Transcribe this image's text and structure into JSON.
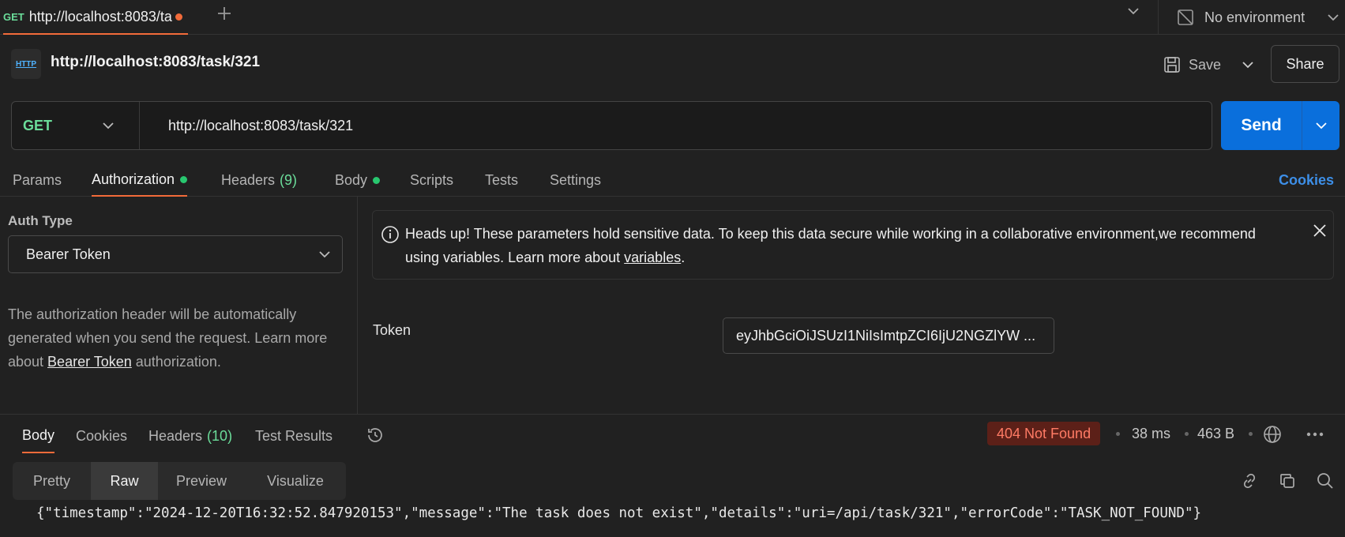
{
  "tab": {
    "method": "GET",
    "title": "http://localhost:8083/ta"
  },
  "environment": {
    "label": "No environment"
  },
  "request": {
    "badge": "HTTP",
    "title": "http://localhost:8083/task/321"
  },
  "toolbar": {
    "save_label": "Save",
    "share_label": "Share"
  },
  "urlbar": {
    "method": "GET",
    "url": "http://localhost:8083/task/321",
    "send_label": "Send"
  },
  "request_tabs": {
    "params": "Params",
    "authorization": "Authorization",
    "headers": "Headers",
    "headers_count": "(9)",
    "body": "Body",
    "scripts": "Scripts",
    "tests": "Tests",
    "settings": "Settings",
    "cookies": "Cookies"
  },
  "auth": {
    "type_label": "Auth Type",
    "type_value": "Bearer Token",
    "desc_pre": "The authorization header will be automatically generated when you send the request. Learn more about ",
    "desc_link": "Bearer Token",
    "desc_post": " authorization."
  },
  "notice": {
    "text": "Heads up! These parameters hold sensitive data. To keep this data secure while working in a collaborative environment,we recommend using variables. Learn more about ",
    "link": "variables",
    "suffix": "."
  },
  "token": {
    "label": "Token",
    "value": "eyJhbGciOiJSUzI1NiIsImtpZCI6IjU2NGZlYW ..."
  },
  "response_tabs": {
    "body": "Body",
    "cookies": "Cookies",
    "headers": "Headers",
    "headers_count": "(10)",
    "test_results": "Test Results"
  },
  "response_meta": {
    "status": "404 Not Found",
    "time": "38 ms",
    "size": "463 B"
  },
  "view_modes": {
    "pretty": "Pretty",
    "raw": "Raw",
    "preview": "Preview",
    "visualize": "Visualize"
  },
  "response_body": "{\"timestamp\":\"2024-12-20T16:32:52.847920153\",\"message\":\"The task does not exist\",\"details\":\"uri=/api/task/321\",\"errorCode\":\"TASK_NOT_FOUND\"}",
  "colors": {
    "accent": "#f26b3a",
    "send": "#0a6fdc",
    "method": "#6bdd9a",
    "error": "#ff7b65"
  }
}
